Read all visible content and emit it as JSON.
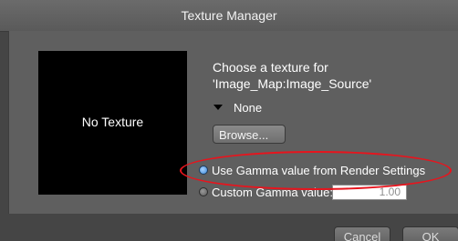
{
  "window": {
    "title": "Texture Manager"
  },
  "preview": {
    "empty_label": "No Texture"
  },
  "prompt": {
    "line1": "Choose a texture for",
    "line2": "'Image_Map:Image_Source'"
  },
  "texture_dropdown": {
    "selected": "None",
    "icon": "triangle-down-icon"
  },
  "browse_button": {
    "label": "Browse..."
  },
  "gamma": {
    "render_settings_option": {
      "label": "Use Gamma value from Render Settings",
      "selected": true
    },
    "custom_option": {
      "label": "Custom Gamma value:",
      "selected": false
    },
    "custom_value": "1.00"
  },
  "footer": {
    "cancel_label": "Cancel",
    "ok_label": "OK"
  },
  "colors": {
    "annotation": "#e8141d",
    "radio_selected": "#3a86d6"
  }
}
